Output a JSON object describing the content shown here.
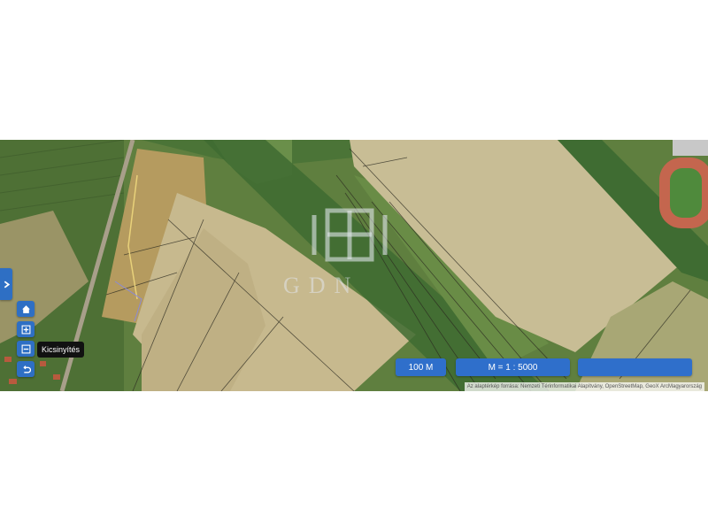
{
  "map": {
    "watermark_text": "GDN",
    "scale_label": "100 M",
    "ratio_label": "M = 1 : 5000",
    "extra_button_label": "",
    "attribution": "Az alaptérkép forrása: Nemzeti Térinformatikai Alapítvány, OpenStreetMap, GeoX ArcMagyarország"
  },
  "controls": {
    "expand": "chevron-right-icon",
    "home": "home-icon",
    "zoom_in": "zoom-in-icon",
    "zoom_out": "zoom-out-icon",
    "back": "undo-icon",
    "tooltip": "Kicsinyítés"
  },
  "colors": {
    "button_blue": "#2f6fcb",
    "field_light": "#c9b98c",
    "field_dark": "#b29a61",
    "vegetation": "#4f7a36"
  }
}
